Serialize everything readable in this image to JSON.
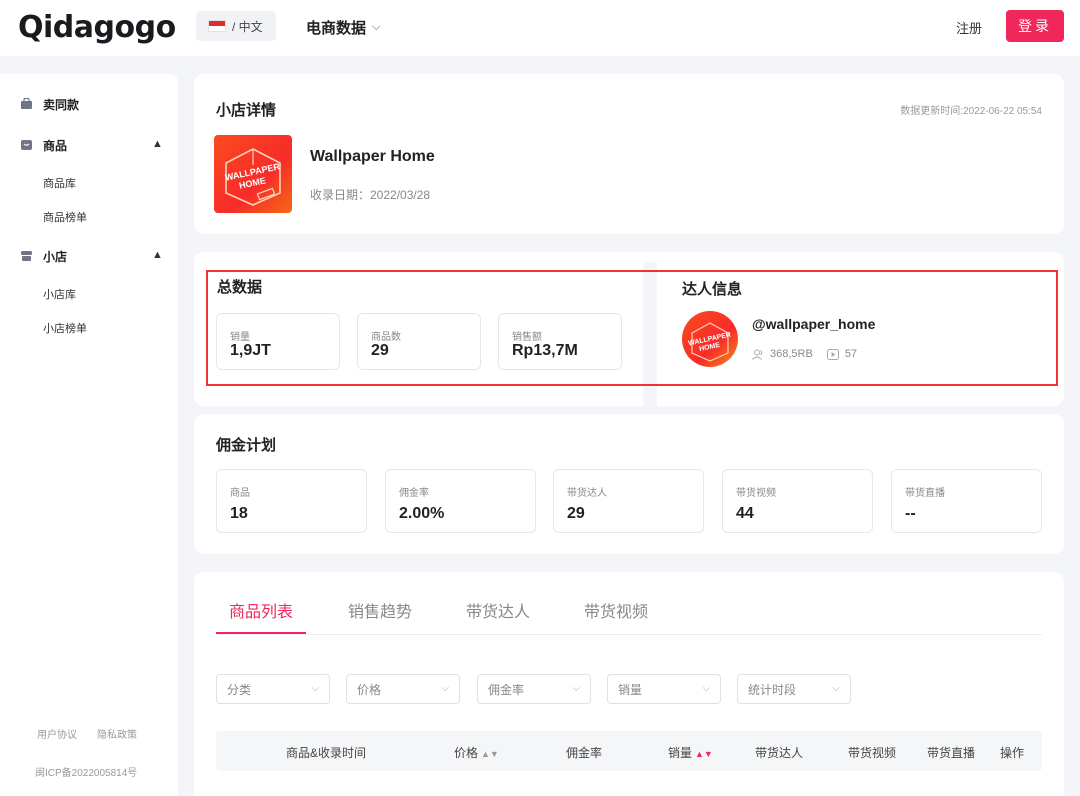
{
  "header": {
    "logo": "Qidagogo",
    "lang": "/ 中文",
    "nav_menu": "电商数据",
    "register": "注册",
    "login": "登录"
  },
  "sidebar": {
    "items": [
      {
        "label": "卖同款",
        "icon": "shop-bag-icon"
      },
      {
        "label": "商品",
        "icon": "product-icon",
        "subs": [
          "商品库",
          "商品榜单"
        ]
      },
      {
        "label": "小店",
        "icon": "store-icon",
        "subs": [
          "小店库",
          "小店榜单"
        ]
      }
    ],
    "footer_links": [
      "用户协议",
      "隐私政策"
    ],
    "icp": "闽ICP备2022005814号"
  },
  "shop": {
    "title": "小店详情",
    "update_time": "数据更新时间:2022-06-22 05:54",
    "logo_text_line1": "WALLPAPER",
    "logo_text_line2": "HOME",
    "name": "Wallpaper Home",
    "date": "收录日期：2022/03/28"
  },
  "totals": {
    "title": "总数据",
    "stats": [
      {
        "label": "销量",
        "value": "1,9JT"
      },
      {
        "label": "商品数",
        "value": "29"
      },
      {
        "label": "销售额",
        "value": "Rp13,7M"
      }
    ]
  },
  "talent": {
    "title": "达人信息",
    "name": "@wallpaper_home",
    "followers": "368,5RB",
    "videos": "57"
  },
  "commission": {
    "title": "佣金计划",
    "stats": [
      {
        "label": "商品",
        "value": "18"
      },
      {
        "label": "佣金率",
        "value": "2.00%"
      },
      {
        "label": "带货达人",
        "value": "29"
      },
      {
        "label": "带货视频",
        "value": "44"
      },
      {
        "label": "带货直播",
        "value": "--"
      }
    ]
  },
  "tabs": [
    "商品列表",
    "销售趋势",
    "带货达人",
    "带货视频"
  ],
  "filters": [
    "分类",
    "价格",
    "佣金率",
    "销量",
    "统计时段"
  ],
  "table": {
    "columns": [
      "商品&收录时间",
      "价格",
      "佣金率",
      "销量",
      "带货达人",
      "带货视频",
      "带货直播",
      "操作"
    ]
  },
  "colors": {
    "accent": "#f0275a",
    "highlight_frame": "#e33333"
  }
}
